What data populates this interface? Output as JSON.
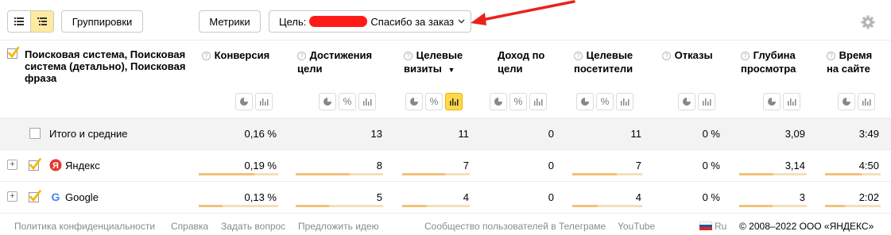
{
  "toolbar": {
    "groupings_label": "Группировки",
    "metrics_label": "Метрики",
    "goal_prefix": "Цель:",
    "goal_value": "Спасибо за заказ"
  },
  "header": {
    "dimensions_label": "Поисковая система, Поисковая система (детально), Поисковая фраза",
    "columns": [
      {
        "label": "Конверсия"
      },
      {
        "label": "Достижения цели"
      },
      {
        "label": "Целевые визиты",
        "sort": "▼"
      },
      {
        "label": "Доход по цели"
      },
      {
        "label": "Целевые посетители"
      },
      {
        "label": "Отказы"
      },
      {
        "label": "Глубина просмотра"
      },
      {
        "label": "Время на сайте"
      }
    ]
  },
  "rows": {
    "total": {
      "name": "Итого и средние",
      "values": [
        "0,16 %",
        "13",
        "11",
        "0",
        "11",
        "0 %",
        "3,09",
        "3:49"
      ]
    },
    "items": [
      {
        "name": "Яндекс",
        "expander": "+",
        "values": [
          "0,19 %",
          "8",
          "7",
          "0",
          "7",
          "0 %",
          "3,14",
          "4:50"
        ],
        "fractions": [
          0.7,
          0.62,
          0.64,
          0,
          0.64,
          0,
          0.5,
          0.65
        ]
      },
      {
        "name": "Google",
        "expander": "+",
        "values": [
          "0,13 %",
          "5",
          "4",
          "0",
          "4",
          "0 %",
          "3",
          "2:02"
        ],
        "fractions": [
          0.3,
          0.38,
          0.36,
          0,
          0.36,
          0,
          0.49,
          0.35
        ]
      }
    ]
  },
  "footer": {
    "links": [
      "Политика конфиденциальности",
      "Справка",
      "Задать вопрос",
      "Предложить идею",
      "Сообщество пользователей в Телеграме",
      "YouTube"
    ],
    "lang": "Ru",
    "copyright": "© 2008–2022 ООО «ЯНДЕКС»"
  },
  "colors": {
    "accent_yellow": "#ffd94a",
    "bar_fill": "#f0c27a",
    "bar_track": "#f5dfb8",
    "redaction": "#ff1a1a"
  }
}
